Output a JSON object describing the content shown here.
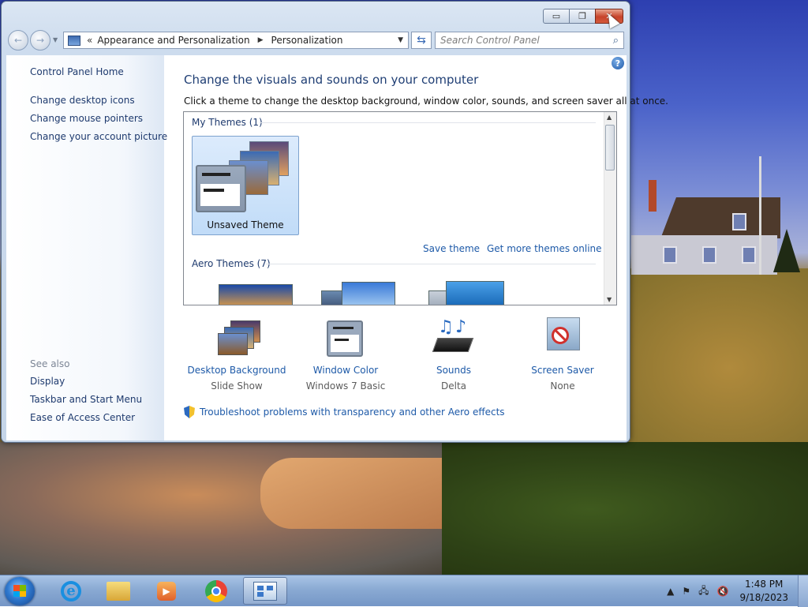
{
  "window": {
    "minimize_glyph": "▭",
    "maximize_glyph": "❐",
    "close_glyph": "✕"
  },
  "nav": {
    "back_glyph": "←",
    "forward_glyph": "→",
    "breadcrumb_sep": "«",
    "breadcrumbs": [
      "Appearance and Personalization",
      "Personalization"
    ],
    "crumb_arrow": "▶",
    "dropdown_glyph": "▼",
    "refresh_glyph": "⇆",
    "search_placeholder": "Search Control Panel",
    "search_glyph": "⌕"
  },
  "left_pane": {
    "home": "Control Panel Home",
    "links": [
      "Change desktop icons",
      "Change mouse pointers",
      "Change your account picture"
    ],
    "see_also_label": "See also",
    "see_also": [
      "Display",
      "Taskbar and Start Menu",
      "Ease of Access Center"
    ]
  },
  "main": {
    "help_glyph": "?",
    "title": "Change the visuals and sounds on your computer",
    "subtitle": "Click a theme to change the desktop background, window color, sounds, and screen saver all at once.",
    "my_themes_header": "My Themes (1)",
    "unsaved_theme": "Unsaved Theme",
    "save_theme": "Save theme",
    "get_more_themes": "Get more themes online",
    "aero_themes_header": "Aero Themes (7)",
    "scroll_up": "▲",
    "scroll_down": "▼"
  },
  "bottom": {
    "items": [
      {
        "label": "Desktop Background",
        "value": "Slide Show"
      },
      {
        "label": "Window Color",
        "value": "Windows 7 Basic"
      },
      {
        "label": "Sounds",
        "value": "Delta"
      },
      {
        "label": "Screen Saver",
        "value": "None"
      }
    ],
    "troubleshoot": "Troubleshoot problems with transparency and other Aero effects"
  },
  "taskbar": {
    "media_glyph": "▶",
    "tray_arrow": "▲",
    "flag_glyph": "⚑",
    "network_glyph": "🖧",
    "volume_glyph": "🔇",
    "time": "1:48 PM",
    "date": "9/18/2023"
  },
  "colors": {
    "link": "#1e5aa8",
    "title": "#1f3e74",
    "close_red": "#c7432a",
    "taskbar": "#8aaad3"
  }
}
